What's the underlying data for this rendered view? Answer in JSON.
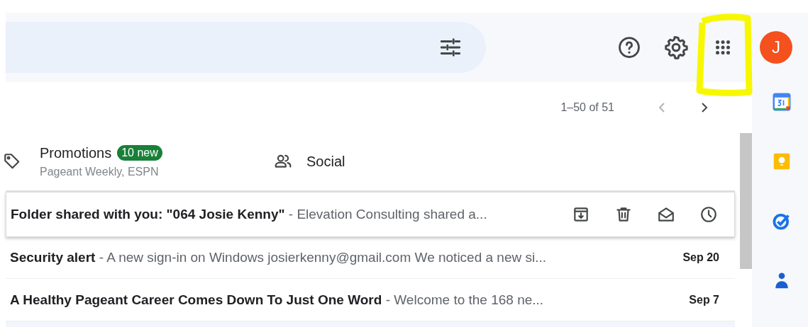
{
  "header": {
    "avatar_letter": "J"
  },
  "annotations": [
    {
      "kind": "marker-outline",
      "color": "#f7f700"
    }
  ],
  "pagination": {
    "range": "1–50 of 51"
  },
  "category_tabs": [
    {
      "kind": "promotions",
      "label": "Promotions",
      "badge": "10 new",
      "senders": "Pageant Weekly, ESPN"
    },
    {
      "kind": "social",
      "label": "Social"
    }
  ],
  "messages": [
    {
      "subject": "Folder shared with you: \"064 Josie Kenny\"",
      "snippet": " - Elevation Consulting shared a...",
      "hovered": true
    },
    {
      "subject": "Security alert",
      "snippet": " - A new sign-in on Windows josierkenny@gmail.com We noticed a new si...",
      "date": "Sep 20",
      "hovered": false
    },
    {
      "subject": "A Healthy Pageant Career Comes Down To Just One Word",
      "snippet": " - Welcome to the 168 ne...",
      "date": "Sep 7",
      "hovered": false
    }
  ]
}
